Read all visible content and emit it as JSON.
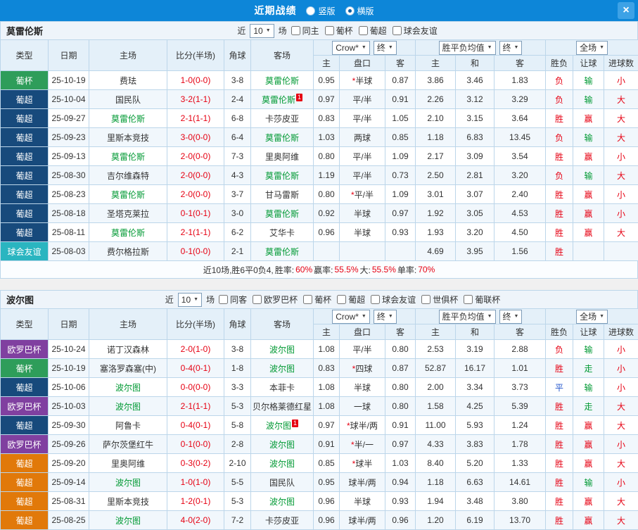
{
  "topbar": {
    "title": "近期战绩",
    "radio_vertical": "竖版",
    "radio_horizontal": "横版",
    "close": "×"
  },
  "labels": {
    "near": "近",
    "games": "场",
    "type": "类型",
    "date": "日期",
    "home": "主场",
    "score": "比分(半场)",
    "corner": "角球",
    "away": "客场",
    "h_home": "主",
    "h_pan": "盘口",
    "h_away": "客",
    "a_home": "主",
    "a_draw": "和",
    "a_away": "客",
    "r_spf": "胜负",
    "r_rq": "让球",
    "r_jq": "进球数",
    "company": "Crow*",
    "final1": "终",
    "avg": "胜平负均值",
    "final2": "终",
    "scope": "全场"
  },
  "colors": {
    "cup_green": "#2e9d5a",
    "league_navy": "#174a7c",
    "friendly_teal": "#2ab5c0",
    "europa_purple": "#8040a0",
    "league_orange": "#e1790a",
    "win_red": "#e60012",
    "lose_green": "#009933",
    "draw_blue": "#2255cc",
    "team_green": "#009933"
  },
  "sections": [
    {
      "title": "莫雷伦斯",
      "filter": {
        "count": "10",
        "checkboxes": [
          "同主",
          "葡杯",
          "葡超",
          "球会友谊"
        ]
      },
      "rows": [
        {
          "type": "葡杯",
          "bg": "#2e9d5a",
          "date": "25-10-19",
          "home": "费珐",
          "score": "1-0(0-0)",
          "corner": "3-8",
          "away": "莫雷伦斯",
          "ah": 1,
          "o1": "0.95",
          "star": 1,
          "pan": "半球",
          "o2": "0.87",
          "a1": "3.86",
          "a2": "3.46",
          "a3": "1.83",
          "spf": "负",
          "sc": "r",
          "rq": "输",
          "rc": "g",
          "jq": "小",
          "jc": "r"
        },
        {
          "type": "葡超",
          "bg": "#174a7c",
          "date": "25-10-04",
          "home": "国民队",
          "score": "3-2(1-1)",
          "corner": "2-4",
          "away": "莫雷伦斯",
          "ah": 1,
          "ar": 1,
          "o1": "0.97",
          "pan": "平/半",
          "o2": "0.91",
          "a1": "2.26",
          "a2": "3.12",
          "a3": "3.29",
          "spf": "负",
          "sc": "r",
          "rq": "输",
          "rc": "g",
          "jq": "大",
          "jc": "r"
        },
        {
          "type": "葡超",
          "bg": "#174a7c",
          "date": "25-09-27",
          "home": "莫雷伦斯",
          "hh": 1,
          "score": "2-1(1-1)",
          "corner": "6-8",
          "away": "卡莎皮亚",
          "o1": "0.83",
          "pan": "平/半",
          "o2": "1.05",
          "a1": "2.10",
          "a2": "3.15",
          "a3": "3.64",
          "spf": "胜",
          "sc": "r",
          "rq": "赢",
          "rc": "r",
          "jq": "大",
          "jc": "r"
        },
        {
          "type": "葡超",
          "bg": "#174a7c",
          "date": "25-09-23",
          "home": "里斯本竞技",
          "score": "3-0(0-0)",
          "corner": "6-4",
          "away": "莫雷伦斯",
          "ah": 1,
          "o1": "1.03",
          "pan": "两球",
          "o2": "0.85",
          "a1": "1.18",
          "a2": "6.83",
          "a3": "13.45",
          "spf": "负",
          "sc": "r",
          "rq": "输",
          "rc": "g",
          "jq": "大",
          "jc": "r"
        },
        {
          "type": "葡超",
          "bg": "#174a7c",
          "date": "25-09-13",
          "home": "莫雷伦斯",
          "hh": 1,
          "score": "2-0(0-0)",
          "corner": "7-3",
          "away": "里奥阿维",
          "o1": "0.80",
          "pan": "平/半",
          "o2": "1.09",
          "a1": "2.17",
          "a2": "3.09",
          "a3": "3.54",
          "spf": "胜",
          "sc": "r",
          "rq": "赢",
          "rc": "r",
          "jq": "小",
          "jc": "r"
        },
        {
          "type": "葡超",
          "bg": "#174a7c",
          "date": "25-08-30",
          "home": "吉尔维森特",
          "score": "2-0(0-0)",
          "corner": "4-3",
          "away": "莫雷伦斯",
          "ah": 1,
          "o1": "1.19",
          "pan": "平/半",
          "o2": "0.73",
          "a1": "2.50",
          "a2": "2.81",
          "a3": "3.20",
          "spf": "负",
          "sc": "r",
          "rq": "输",
          "rc": "g",
          "jq": "大",
          "jc": "r"
        },
        {
          "type": "葡超",
          "bg": "#174a7c",
          "date": "25-08-23",
          "home": "莫雷伦斯",
          "hh": 1,
          "score": "2-0(0-0)",
          "corner": "3-7",
          "away": "甘马雷斯",
          "o1": "0.80",
          "star": 1,
          "pan": "平/半",
          "o2": "1.09",
          "a1": "3.01",
          "a2": "3.07",
          "a3": "2.40",
          "spf": "胜",
          "sc": "r",
          "rq": "赢",
          "rc": "r",
          "jq": "小",
          "jc": "r"
        },
        {
          "type": "葡超",
          "bg": "#174a7c",
          "date": "25-08-18",
          "home": "圣塔克莱拉",
          "score": "0-1(0-1)",
          "corner": "3-0",
          "away": "莫雷伦斯",
          "ah": 1,
          "o1": "0.92",
          "pan": "半球",
          "o2": "0.97",
          "a1": "1.92",
          "a2": "3.05",
          "a3": "4.53",
          "spf": "胜",
          "sc": "r",
          "rq": "赢",
          "rc": "r",
          "jq": "小",
          "jc": "r"
        },
        {
          "type": "葡超",
          "bg": "#174a7c",
          "date": "25-08-11",
          "home": "莫雷伦斯",
          "hh": 1,
          "score": "2-1(1-1)",
          "corner": "6-2",
          "away": "艾华卡",
          "o1": "0.96",
          "pan": "半球",
          "o2": "0.93",
          "a1": "1.93",
          "a2": "3.20",
          "a3": "4.50",
          "spf": "胜",
          "sc": "r",
          "rq": "赢",
          "rc": "r",
          "jq": "大",
          "jc": "r"
        },
        {
          "type": "球会友谊",
          "bg": "#2ab5c0",
          "date": "25-08-03",
          "home": "费尔格拉斯",
          "score": "0-1(0-0)",
          "corner": "2-1",
          "away": "莫雷伦斯",
          "ah": 1,
          "o1": "",
          "pan": "",
          "o2": "",
          "a1": "4.69",
          "a2": "3.95",
          "a3": "1.56",
          "spf": "胜",
          "sc": "r",
          "rq": "",
          "jq": ""
        }
      ],
      "summary": {
        "prefix": "近10场,胜6平0负4, ",
        "stats": [
          [
            "胜率:",
            "60%"
          ],
          [
            " 赢率:",
            "55.5%"
          ],
          [
            " 大:",
            "55.5%"
          ],
          [
            " 单率:",
            "70%"
          ]
        ]
      }
    },
    {
      "title": "波尔图",
      "filter": {
        "count": "10",
        "checkboxes": [
          "同客",
          "欧罗巴杯",
          "葡杯",
          "葡超",
          "球会友谊",
          "世俱杯",
          "葡联杯"
        ]
      },
      "rows": [
        {
          "type": "欧罗巴杯",
          "bg": "#8040a0",
          "date": "25-10-24",
          "home": "诺丁汉森林",
          "score": "2-0(1-0)",
          "corner": "3-8",
          "away": "波尔图",
          "ah": 1,
          "o1": "1.08",
          "pan": "平/半",
          "o2": "0.80",
          "a1": "2.53",
          "a2": "3.19",
          "a3": "2.88",
          "spf": "负",
          "sc": "r",
          "rq": "输",
          "rc": "g",
          "jq": "小",
          "jc": "r"
        },
        {
          "type": "葡杯",
          "bg": "#2e9d5a",
          "date": "25-10-19",
          "home": "塞洛罗森塞(中)",
          "score": "0-4(0-1)",
          "corner": "1-8",
          "away": "波尔图",
          "ah": 1,
          "o1": "0.83",
          "star": 1,
          "pan": "四球",
          "o2": "0.87",
          "a1": "52.87",
          "a2": "16.17",
          "a3": "1.01",
          "spf": "胜",
          "sc": "r",
          "rq": "走",
          "rc": "g",
          "jq": "小",
          "jc": "r"
        },
        {
          "type": "葡超",
          "bg": "#174a7c",
          "date": "25-10-06",
          "home": "波尔图",
          "hh": 1,
          "score": "0-0(0-0)",
          "corner": "3-3",
          "away": "本菲卡",
          "o1": "1.08",
          "pan": "半球",
          "o2": "0.80",
          "a1": "2.00",
          "a2": "3.34",
          "a3": "3.73",
          "spf": "平",
          "sc": "b",
          "rq": "输",
          "rc": "g",
          "jq": "小",
          "jc": "r"
        },
        {
          "type": "欧罗巴杯",
          "bg": "#8040a0",
          "date": "25-10-03",
          "home": "波尔图",
          "hh": 1,
          "score": "2-1(1-1)",
          "corner": "5-3",
          "away": "贝尔格莱德红星",
          "o1": "1.08",
          "pan": "一球",
          "o2": "0.80",
          "a1": "1.58",
          "a2": "4.25",
          "a3": "5.39",
          "spf": "胜",
          "sc": "r",
          "rq": "走",
          "rc": "g",
          "jq": "大",
          "jc": "r"
        },
        {
          "type": "葡超",
          "bg": "#174a7c",
          "date": "25-09-30",
          "home": "阿鲁卡",
          "score": "0-4(0-1)",
          "corner": "5-8",
          "away": "波尔图",
          "ah": 1,
          "ar": 1,
          "o1": "0.97",
          "star": 1,
          "pan": "球半/两",
          "o2": "0.91",
          "a1": "11.00",
          "a2": "5.93",
          "a3": "1.24",
          "spf": "胜",
          "sc": "r",
          "rq": "赢",
          "rc": "r",
          "jq": "大",
          "jc": "r"
        },
        {
          "type": "欧罗巴杯",
          "bg": "#8040a0",
          "date": "25-09-26",
          "home": "萨尔茨堡红牛",
          "score": "0-1(0-0)",
          "corner": "2-8",
          "away": "波尔图",
          "ah": 1,
          "o1": "0.91",
          "star": 1,
          "pan": "半/一",
          "o2": "0.97",
          "a1": "4.33",
          "a2": "3.83",
          "a3": "1.78",
          "spf": "胜",
          "sc": "r",
          "rq": "赢",
          "rc": "r",
          "jq": "小",
          "jc": "r"
        },
        {
          "type": "葡超",
          "bg": "#e1790a",
          "date": "25-09-20",
          "home": "里奥阿维",
          "score": "0-3(0-2)",
          "corner": "2-10",
          "away": "波尔图",
          "ah": 1,
          "o1": "0.85",
          "star": 1,
          "pan": "球半",
          "o2": "1.03",
          "a1": "8.40",
          "a2": "5.20",
          "a3": "1.33",
          "spf": "胜",
          "sc": "r",
          "rq": "赢",
          "rc": "r",
          "jq": "大",
          "jc": "r"
        },
        {
          "type": "葡超",
          "bg": "#e1790a",
          "date": "25-09-14",
          "home": "波尔图",
          "hh": 1,
          "score": "1-0(1-0)",
          "corner": "5-5",
          "away": "国民队",
          "o1": "0.95",
          "pan": "球半/两",
          "o2": "0.94",
          "a1": "1.18",
          "a2": "6.63",
          "a3": "14.61",
          "spf": "胜",
          "sc": "r",
          "rq": "输",
          "rc": "g",
          "jq": "小",
          "jc": "r"
        },
        {
          "type": "葡超",
          "bg": "#e1790a",
          "date": "25-08-31",
          "home": "里斯本竞技",
          "score": "1-2(0-1)",
          "corner": "5-3",
          "away": "波尔图",
          "ah": 1,
          "o1": "0.96",
          "pan": "半球",
          "o2": "0.93",
          "a1": "1.94",
          "a2": "3.48",
          "a3": "3.80",
          "spf": "胜",
          "sc": "r",
          "rq": "赢",
          "rc": "r",
          "jq": "大",
          "jc": "r"
        },
        {
          "type": "葡超",
          "bg": "#e1790a",
          "date": "25-08-25",
          "home": "波尔图",
          "hh": 1,
          "score": "4-0(2-0)",
          "corner": "7-2",
          "away": "卡莎皮亚",
          "o1": "0.96",
          "pan": "球半/两",
          "o2": "0.96",
          "a1": "1.20",
          "a2": "6.19",
          "a3": "13.70",
          "spf": "胜",
          "sc": "r",
          "rq": "赢",
          "rc": "r",
          "jq": "大",
          "jc": "r"
        }
      ],
      "summary": null
    }
  ]
}
